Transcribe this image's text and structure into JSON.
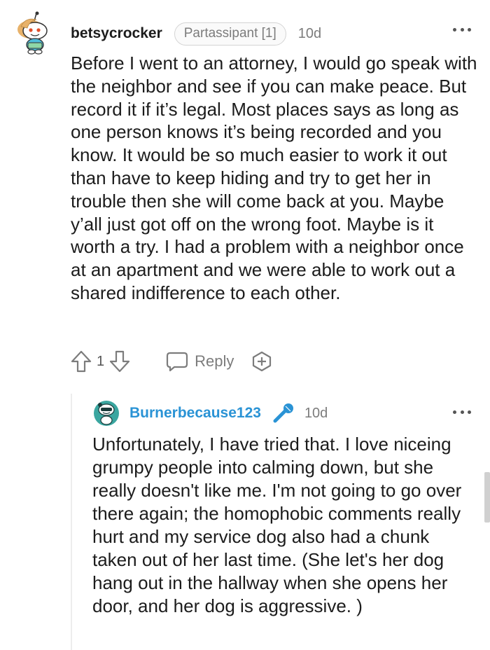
{
  "top_comment": {
    "username": "betsycrocker",
    "flair": "Partassipant [1]",
    "age": "10d",
    "body": "Before I went to an attorney, I would go speak with the neighbor and see if you can make peace. But record it if it’s legal. Most places says as long as one person knows it’s being recorded and you know. It would be so much easier to work it out than have to keep hiding and try to get her in trouble then she will come back at you. Maybe y’all just got off on the wrong foot. Maybe is it worth a try. I had a problem with a neighbor once at an apartment and we were able to work out a shared indifference to each other.",
    "vote_count": "1",
    "reply_label": "Reply",
    "icons": {
      "avatar": "snoo-avatar-icon",
      "more": "more-dots-icon",
      "upvote": "upvote-arrow-icon",
      "downvote": "downvote-arrow-icon",
      "reply": "speech-bubble-icon",
      "award": "award-plus-icon"
    }
  },
  "reply_comment": {
    "username": "Burnerbecause123",
    "age": "10d",
    "body": "Unfortunately, I have tried that. I love niceing grumpy people into calming down, but she really doesn't like me. I'm not going to go over there again; the homophobic comments really hurt and my service dog also had a chunk taken out of her last time. (She let's her dog hang out in the hallway when she opens her door, and her dog is aggressive. )",
    "icons": {
      "avatar": "snoo-avatar-icon",
      "op_badge": "microphone-icon",
      "more": "more-dots-icon"
    }
  },
  "colors": {
    "op_username": "#2a93d5",
    "meta_gray": "#7c7c7c",
    "text": "#1c1c1c"
  }
}
